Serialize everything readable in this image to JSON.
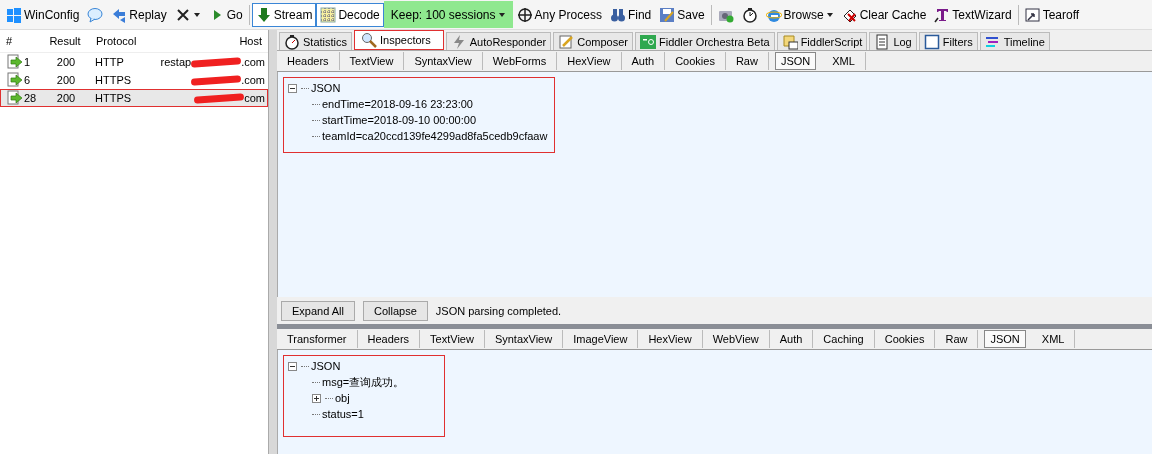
{
  "toolbar": [
    {
      "kind": "button",
      "label": "WinConfig"
    },
    {
      "kind": "button"
    },
    {
      "kind": "button",
      "label": "Replay"
    },
    {
      "kind": "dropdown"
    },
    {
      "kind": "button",
      "label": "Go"
    },
    {
      "kind": "toggle",
      "label": "Stream"
    },
    {
      "kind": "toggle",
      "label": "Decode"
    },
    {
      "kind": "keep",
      "label": "Keep: 100 sessions"
    },
    {
      "kind": "button",
      "label": "Any Process"
    },
    {
      "kind": "button",
      "label": "Find"
    },
    {
      "kind": "button",
      "label": "Save"
    },
    {
      "kind": "button"
    },
    {
      "kind": "button"
    },
    {
      "kind": "dropdown",
      "label": "Browse"
    },
    {
      "kind": "button",
      "label": "Clear Cache"
    },
    {
      "kind": "button",
      "label": "TextWizard"
    },
    {
      "kind": "button",
      "label": "Tearoff"
    }
  ],
  "sessions": {
    "columns": [
      "#",
      "Result",
      "Protocol",
      "Host"
    ],
    "rows": [
      {
        "id": "1",
        "result": "200",
        "protocol": "HTTP",
        "host_parts": [
          "restap",
          ".com"
        ],
        "selected": false,
        "annotated": false
      },
      {
        "id": "6",
        "result": "200",
        "protocol": "HTTPS",
        "host_parts": [
          ".com"
        ],
        "selected": false,
        "annotated": false
      },
      {
        "id": "28",
        "result": "200",
        "protocol": "HTTPS",
        "host_parts": [
          "com"
        ],
        "selected": true,
        "annotated": true
      }
    ]
  },
  "tabs": [
    {
      "label": "Statistics",
      "selected": false,
      "annotated": false
    },
    {
      "label": "Inspectors",
      "selected": true,
      "annotated": true
    },
    {
      "label": "AutoResponder",
      "selected": false,
      "annotated": false
    },
    {
      "label": "Composer",
      "selected": false,
      "annotated": false
    },
    {
      "label": "Fiddler Orchestra Beta",
      "selected": false,
      "annotated": false
    },
    {
      "label": "FiddlerScript",
      "selected": false,
      "annotated": false
    },
    {
      "label": "Log",
      "selected": false,
      "annotated": false
    },
    {
      "label": "Filters",
      "selected": false,
      "annotated": false
    },
    {
      "label": "Timeline",
      "selected": false,
      "annotated": false
    }
  ],
  "request": {
    "tabs": [
      {
        "label": "Headers",
        "selected": false
      },
      {
        "label": "TextView",
        "selected": false
      },
      {
        "label": "SyntaxView",
        "selected": false
      },
      {
        "label": "WebForms",
        "selected": false
      },
      {
        "label": "HexView",
        "selected": false
      },
      {
        "label": "Auth",
        "selected": false
      },
      {
        "label": "Cookies",
        "selected": false
      },
      {
        "label": "Raw",
        "selected": false
      },
      {
        "label": "JSON",
        "selected": true
      },
      {
        "label": "XML",
        "selected": false
      }
    ],
    "tree": {
      "annotated": true,
      "nodes": [
        {
          "label": "JSON",
          "expanded": true,
          "children": [
            {
              "label": "endTime=2018-09-16 23:23:00"
            },
            {
              "label": "startTime=2018-09-10 00:00:00"
            },
            {
              "label": "teamId=ca20ccd139fe4299ad8fa5cedb9cfaaw"
            }
          ]
        }
      ]
    },
    "buttons": [
      "Expand All",
      "Collapse"
    ],
    "status": "JSON parsing completed."
  },
  "response": {
    "tabs": [
      {
        "label": "Transformer",
        "selected": false
      },
      {
        "label": "Headers",
        "selected": false
      },
      {
        "label": "TextView",
        "selected": false
      },
      {
        "label": "SyntaxView",
        "selected": false
      },
      {
        "label": "ImageView",
        "selected": false
      },
      {
        "label": "HexView",
        "selected": false
      },
      {
        "label": "WebView",
        "selected": false
      },
      {
        "label": "Auth",
        "selected": false
      },
      {
        "label": "Caching",
        "selected": false
      },
      {
        "label": "Cookies",
        "selected": false
      },
      {
        "label": "Raw",
        "selected": false
      },
      {
        "label": "JSON",
        "selected": true
      },
      {
        "label": "XML",
        "selected": false
      }
    ],
    "tree": {
      "annotated": true,
      "nodes": [
        {
          "label": "JSON",
          "expanded": true,
          "children": [
            {
              "label": "msg=查询成功。"
            },
            {
              "label": "obj",
              "expanded": false
            },
            {
              "label": "status=1"
            }
          ]
        }
      ]
    }
  }
}
